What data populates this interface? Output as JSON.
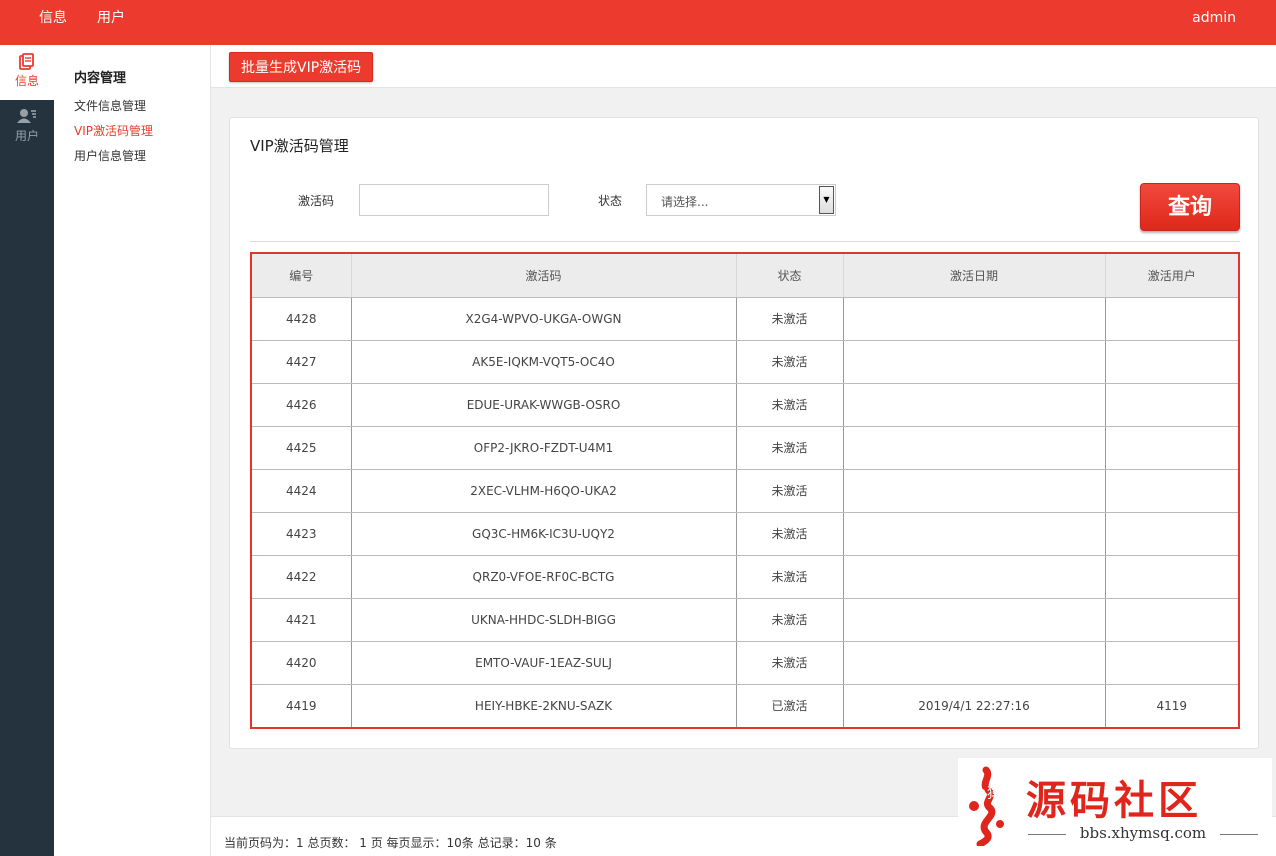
{
  "topbar": {
    "nav": [
      "信息",
      "用户"
    ],
    "user": "admin"
  },
  "leftbar": {
    "items": [
      {
        "label": "信息",
        "icon": "document-icon"
      },
      {
        "label": "用户",
        "icon": "user-list-icon"
      }
    ]
  },
  "sidebar": {
    "group": "内容管理",
    "links": [
      "文件信息管理",
      "VIP激活码管理",
      "用户信息管理"
    ],
    "active_index": 1
  },
  "toolbar": {
    "batch_label": "批量生成VIP激活码"
  },
  "panel": {
    "title": "VIP激活码管理",
    "code_label": "激活码",
    "code_value": "",
    "status_label": "状态",
    "status_placeholder": "请选择...",
    "query_label": "查询"
  },
  "table": {
    "headers": [
      "编号",
      "激活码",
      "状态",
      "激活日期",
      "激活用户"
    ],
    "rows": [
      [
        "4428",
        "X2G4-WPVO-UKGA-OWGN",
        "未激活",
        "",
        ""
      ],
      [
        "4427",
        "AK5E-IQKM-VQT5-OC4O",
        "未激活",
        "",
        ""
      ],
      [
        "4426",
        "EDUE-URAK-WWGB-OSRO",
        "未激活",
        "",
        ""
      ],
      [
        "4425",
        "OFP2-JKRO-FZDT-U4M1",
        "未激活",
        "",
        ""
      ],
      [
        "4424",
        "2XEC-VLHM-H6QO-UKA2",
        "未激活",
        "",
        ""
      ],
      [
        "4423",
        "GQ3C-HM6K-IC3U-UQY2",
        "未激活",
        "",
        ""
      ],
      [
        "4422",
        "QRZ0-VFOE-RF0C-BCTG",
        "未激活",
        "",
        ""
      ],
      [
        "4421",
        "UKNA-HHDC-SLDH-BIGG",
        "未激活",
        "",
        ""
      ],
      [
        "4420",
        "EMTO-VAUF-1EAZ-SULJ",
        "未激活",
        "",
        ""
      ],
      [
        "4419",
        "HEIY-HBKE-2KNU-SAZK",
        "已激活",
        "2019/4/1 22:27:16",
        "4119"
      ]
    ]
  },
  "footer": {
    "info": "当前页码为：1 总页数： 1 页 每页显示：10条 总记录：10 条"
  },
  "watermark": {
    "title": "源码社区",
    "url": "bbs.xhymsq.com",
    "seal_text": "小猿"
  },
  "colors": {
    "accent": "#ec3b2e",
    "sidebar_dark": "#24333e"
  }
}
